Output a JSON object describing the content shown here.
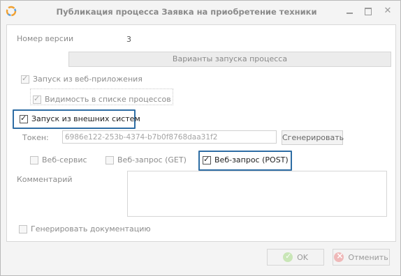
{
  "window": {
    "title": "Публикация процесса Заявка на приобретение техники"
  },
  "version": {
    "label": "Номер версии",
    "value": "3"
  },
  "launch_section": {
    "header": "Варианты запуска процесса"
  },
  "checkboxes": {
    "web_app": {
      "label": "Запуск из веб-приложения",
      "checked": true
    },
    "process_list": {
      "label": "Видимость в списке процессов",
      "checked": true
    },
    "external": {
      "label": "Запуск из внешних систем",
      "checked": true
    }
  },
  "token": {
    "label": "Токен:",
    "value": "6986e122-253b-4374-b7b0f8768daa31f2",
    "generate_label": "Сгенерировать"
  },
  "methods": {
    "web_service": {
      "label": "Веб-сервис",
      "checked": false
    },
    "get": {
      "label": "Веб-запрос (GET)",
      "checked": false
    },
    "post": {
      "label": "Веб-запрос (POST)",
      "checked": true
    }
  },
  "comment": {
    "label": "Комментарий",
    "value": ""
  },
  "generate_docs": {
    "label": "Генерировать документацию",
    "checked": false
  },
  "buttons": {
    "ok_label": "OK",
    "cancel_label": "Отменить"
  },
  "colors": {
    "highlight": "#2e6da4",
    "ok_icon": "#c9e6b7",
    "cancel_icon": "#efb9b9"
  },
  "icons": {
    "app": "app-logo-icon",
    "minimize": "minimize-icon",
    "maximize": "maximize-icon",
    "close": "close-icon",
    "ok": "check-circle-icon",
    "cancel": "cancel-circle-icon"
  }
}
